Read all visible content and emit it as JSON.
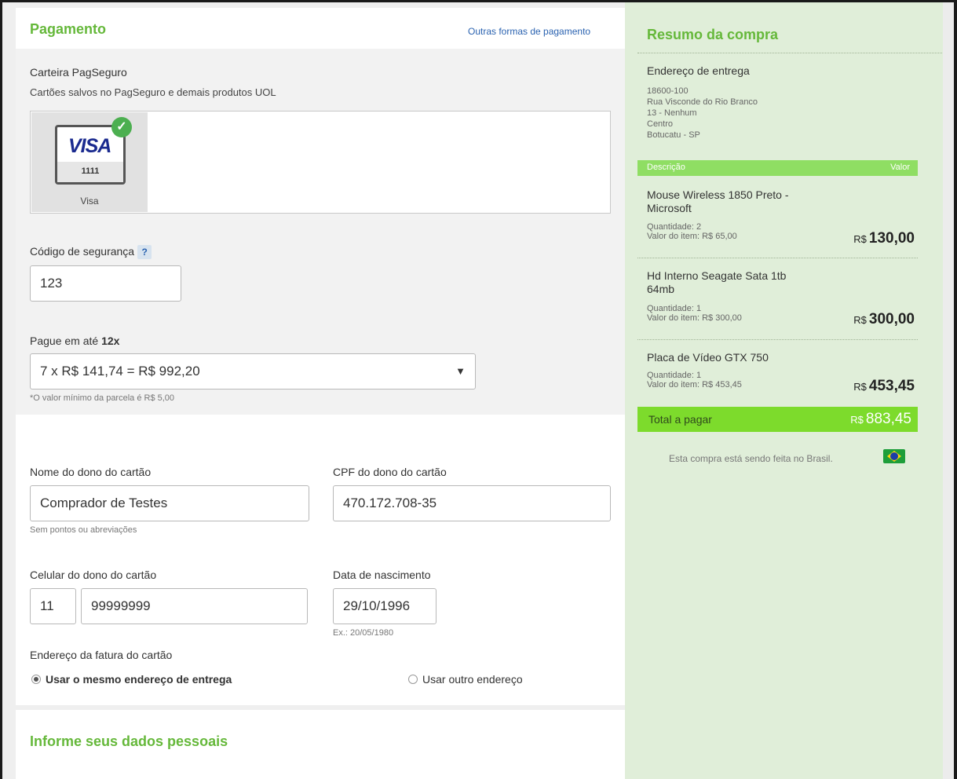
{
  "payment": {
    "title": "Pagamento",
    "other_methods_link": "Outras formas de pagamento",
    "wallet_title": "Carteira PagSeguro",
    "wallet_subtitle": "Cartões salvos no PagSeguro e demais produtos UOL",
    "saved_cards": [
      {
        "brand_logo": "VISA",
        "last_digits": "1111",
        "label": "Visa",
        "selected": true
      }
    ],
    "security_code": {
      "label": "Código de segurança",
      "help": "?",
      "value": "123"
    },
    "installments": {
      "label_prefix": "Pague em até",
      "label_max": "12x",
      "selected": "7 x R$ 141,74 = R$ 992,20",
      "note": "*O valor mínimo da parcela é R$ 5,00"
    },
    "holder_name": {
      "label": "Nome do dono do cartão",
      "value": "Comprador de Testes",
      "hint": "Sem pontos ou abreviações"
    },
    "holder_cpf": {
      "label": "CPF do dono do cartão",
      "value": "470.172.708-35"
    },
    "holder_phone": {
      "label": "Celular do dono do cartão",
      "ddd": "11",
      "number": "99999999"
    },
    "birth_date": {
      "label": "Data de nascimento",
      "value": "29/10/1996",
      "example": "Ex.: 20/05/1980"
    },
    "billing_address": {
      "label": "Endereço da fatura do cartão",
      "option_same": "Usar o mesmo endereço de entrega",
      "option_other": "Usar outro endereço",
      "selected": "same"
    }
  },
  "personal": {
    "title": "Informe seus dados pessoais"
  },
  "summary": {
    "title": "Resumo da compra",
    "delivery_label": "Endereço de entrega",
    "address_lines": [
      "18600-100",
      "Rua Visconde do Rio Branco",
      "13 - Nenhum",
      "Centro",
      "Botucatu - SP"
    ],
    "col_description": "Descrição",
    "col_value": "Valor",
    "items": [
      {
        "name_line1": "Mouse Wireless 1850 Preto -",
        "name_line2": "Microsoft",
        "quantity": "Quantidade: 2",
        "unit_value": "Valor do item: R$ 65,00",
        "currency": "R$",
        "total": "130,00"
      },
      {
        "name_line1": "Hd Interno Seagate Sata 1tb",
        "name_line2": "64mb",
        "quantity": "Quantidade: 1",
        "unit_value": "Valor do item: R$ 300,00",
        "currency": "R$",
        "total": "300,00"
      },
      {
        "name_line1": "Placa de Vídeo GTX 750",
        "name_line2": "",
        "quantity": "Quantidade: 1",
        "unit_value": "Valor do item: R$ 453,45",
        "currency": "R$",
        "total": "453,45"
      }
    ],
    "total_label": "Total a pagar",
    "total_currency": "R$",
    "total_value": "883,45",
    "country_note": "Esta compra está sendo feita no Brasil.",
    "country_flag": "brazil-flag-icon"
  },
  "colors": {
    "accent_green": "#65b83a",
    "summary_bg": "#e0eed9",
    "total_bar": "#7ddb2c",
    "link_blue": "#2a62b0"
  }
}
